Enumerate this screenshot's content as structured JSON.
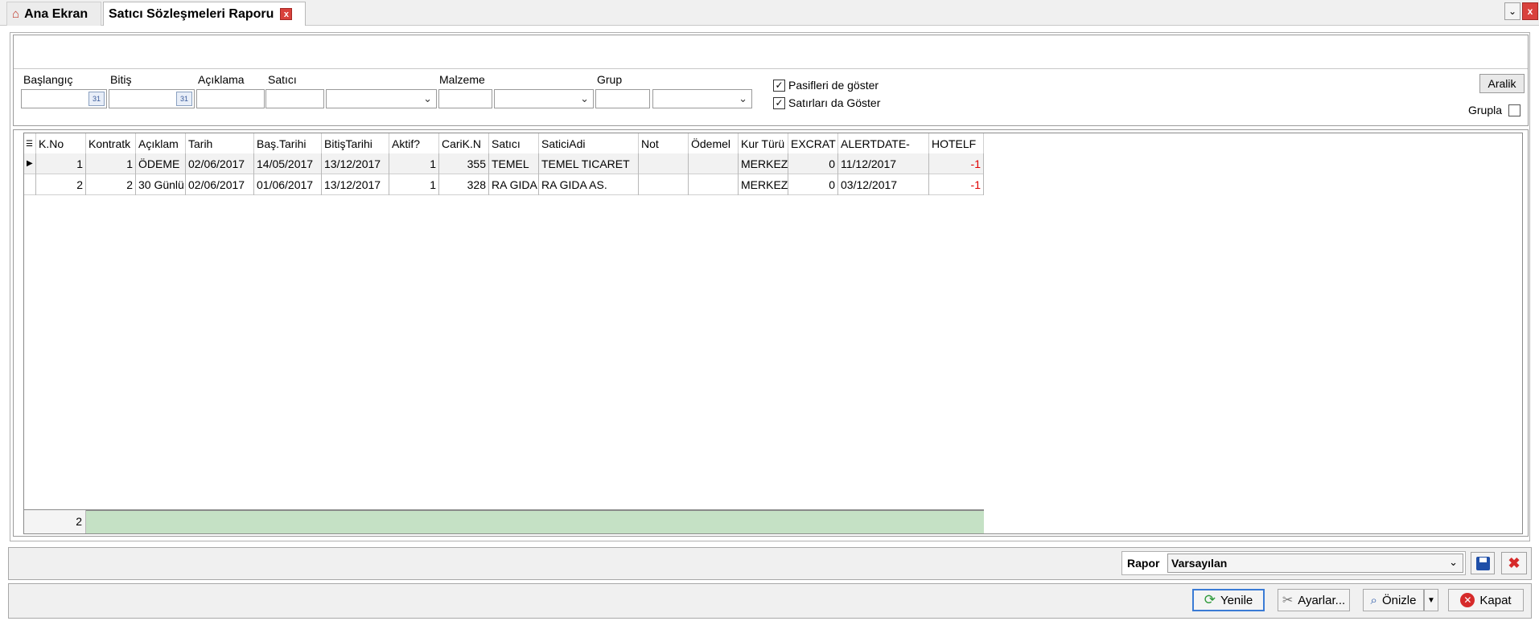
{
  "tabs": {
    "home_label": "Ana Ekran",
    "active_label": "Satıcı Sözleşmeleri Raporu",
    "close_glyph": "x"
  },
  "window": {
    "menu_glyph": "⌄",
    "close_glyph": "x"
  },
  "filters": {
    "labels": {
      "start": "Başlangıç",
      "end": "Bitiş",
      "description": "Açıklama",
      "vendor": "Satıcı",
      "material": "Malzeme",
      "group": "Grup"
    },
    "checkboxes": [
      {
        "label": "Pasifleri de göster",
        "checked": true
      },
      {
        "label": "Satırları da Göster",
        "checked": true
      }
    ],
    "range_button": "Aralik",
    "group_label": "Grupla",
    "group_checked": false
  },
  "grid": {
    "columns": [
      "K.No",
      "Kontratk",
      "Açıklam",
      "Tarih",
      "Baş.Tarihi",
      "BitişTarihi",
      "Aktif?",
      "CariK.N",
      "Satıcı",
      "SaticiAdi",
      "Not",
      "Ödemel",
      "Kur Türü",
      "EXCRAT",
      "ALERTDATE-",
      "HOTELF"
    ],
    "rows": [
      {
        "kno": "1",
        "kontrat": "1",
        "aciklama": "ÖDEME",
        "tarih": "02/06/2017",
        "bas": "14/05/2017",
        "bitis": "13/12/2017",
        "aktif": "1",
        "cari": "355",
        "satici": "TEMEL",
        "saticiadi": "TEMEL TICARET",
        "not": "",
        "odeme": "",
        "kur": "MERKEZ",
        "excrat": "0",
        "alert": "11/12/2017",
        "hotel": "-1"
      },
      {
        "kno": "2",
        "kontrat": "2",
        "aciklama": "30 Günlü",
        "tarih": "02/06/2017",
        "bas": "01/06/2017",
        "bitis": "13/12/2017",
        "aktif": "1",
        "cari": "328",
        "satici": "RA GIDA",
        "saticiadi": "RA GIDA AS.",
        "not": "",
        "odeme": "",
        "kur": "MERKEZ",
        "excrat": "0",
        "alert": "03/12/2017",
        "hotel": "-1"
      }
    ],
    "footer_count": "2"
  },
  "report": {
    "label": "Rapor",
    "selected": "Varsayılan"
  },
  "actions": {
    "refresh": "Yenile",
    "settings": "Ayarlar...",
    "preview": "Önizle",
    "close": "Kapat"
  }
}
